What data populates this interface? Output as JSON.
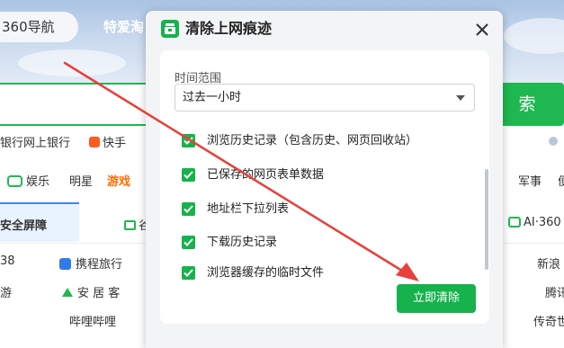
{
  "background": {
    "nav_pill": "360导航",
    "nav_tab2": "特爱淘",
    "search_button": "索",
    "links_row1": {
      "bank": "银行网上银行",
      "kuaishou": "快手"
    },
    "category_row": {
      "yule": "娱乐",
      "mingxing": "明星",
      "youxi": "游戏",
      "junshi": "军事",
      "right_edge": "便"
    },
    "section_row": {
      "anquan": "安全屏障",
      "ai": "AI·360",
      "mid_frag": "谷"
    },
    "sites_row1": {
      "num": "38",
      "ctrip": "携程旅行",
      "xinlang": "新浪"
    },
    "sites_row2": {
      "you": "游",
      "anjuke": "安 居 客",
      "tengxun": "腾讯"
    },
    "sites_row3": {
      "bilibili": "哔哩哔哩",
      "chuanqi": "传奇世"
    },
    "accent_green": "#1fb850"
  },
  "dialog": {
    "title": "清除上网痕迹",
    "icon": "broom-icon",
    "close": "close-icon",
    "range_label": "时间范围",
    "range_value": "过去一小时",
    "options": [
      {
        "label": "浏览历史记录（包含历史、网页回收站）",
        "checked": true
      },
      {
        "label": "已保存的网页表单数据",
        "checked": true
      },
      {
        "label": "地址栏下拉列表",
        "checked": true
      },
      {
        "label": "下载历史记录",
        "checked": true
      },
      {
        "label": "浏览器缓存的临时文件",
        "checked": true
      }
    ],
    "confirm_button": "立即清除",
    "accent_green": "#16b24b"
  },
  "annotation": {
    "arrow_color": "#e8403a"
  }
}
